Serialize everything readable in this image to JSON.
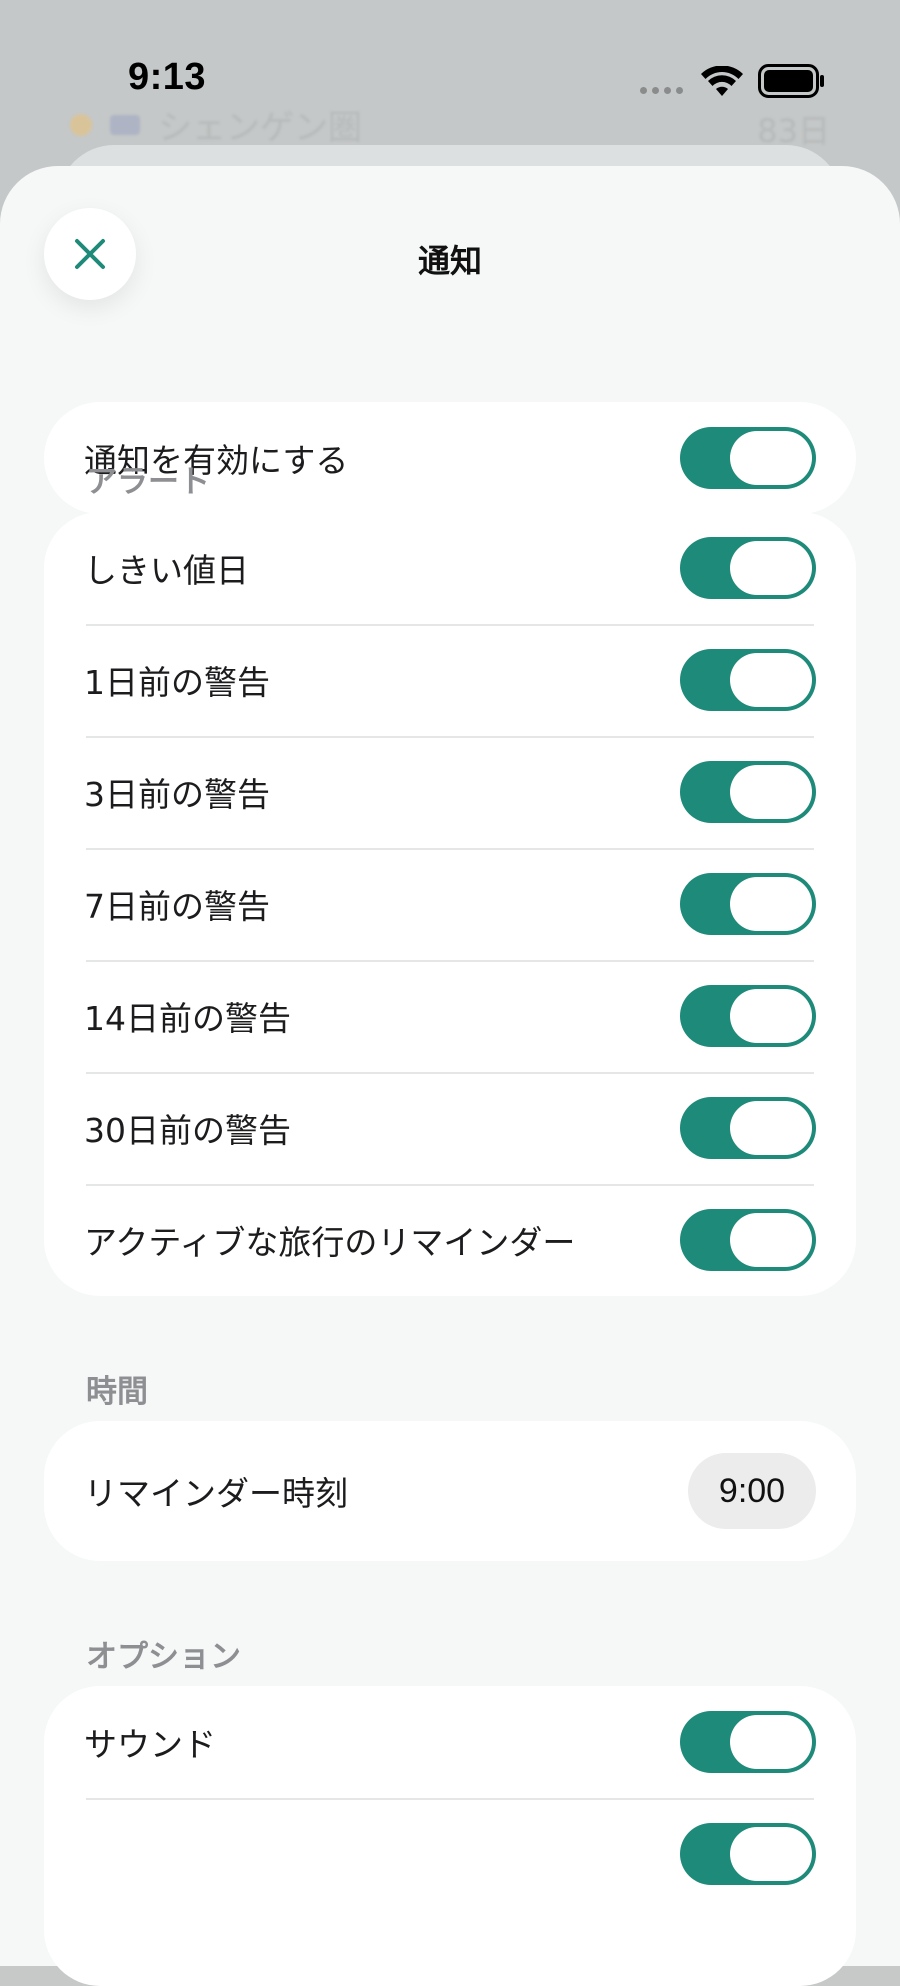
{
  "status_bar": {
    "time": "9:13",
    "icons": [
      "cellular-dots-icon",
      "wifi-icon",
      "battery-icon"
    ]
  },
  "background": {
    "rows": [
      {
        "label": "シェンゲン圏",
        "value": "83日"
      }
    ]
  },
  "sheet": {
    "title": "通知",
    "close_icon": "close-icon"
  },
  "enable_section": {
    "label": "通知を有効にする",
    "enabled": true
  },
  "alerts_section": {
    "header": "アラート",
    "items": [
      {
        "label": "しきい値日",
        "enabled": true
      },
      {
        "label": "1日前の警告",
        "enabled": true
      },
      {
        "label": "3日前の警告",
        "enabled": true
      },
      {
        "label": "7日前の警告",
        "enabled": true
      },
      {
        "label": "14日前の警告",
        "enabled": true
      },
      {
        "label": "30日前の警告",
        "enabled": true
      },
      {
        "label": "アクティブな旅行のリマインダー",
        "enabled": true
      }
    ]
  },
  "time_section": {
    "header": "時間",
    "reminder_label": "リマインダー時刻",
    "reminder_value": "9:00"
  },
  "options_section": {
    "header": "オプション",
    "items": [
      {
        "label": "サウンド",
        "enabled": true
      }
    ]
  },
  "colors": {
    "accent": "#1e8a79",
    "sheet_background": "#f6f8f8",
    "card_background": "#ffffff",
    "section_header": "#8e8f92"
  }
}
